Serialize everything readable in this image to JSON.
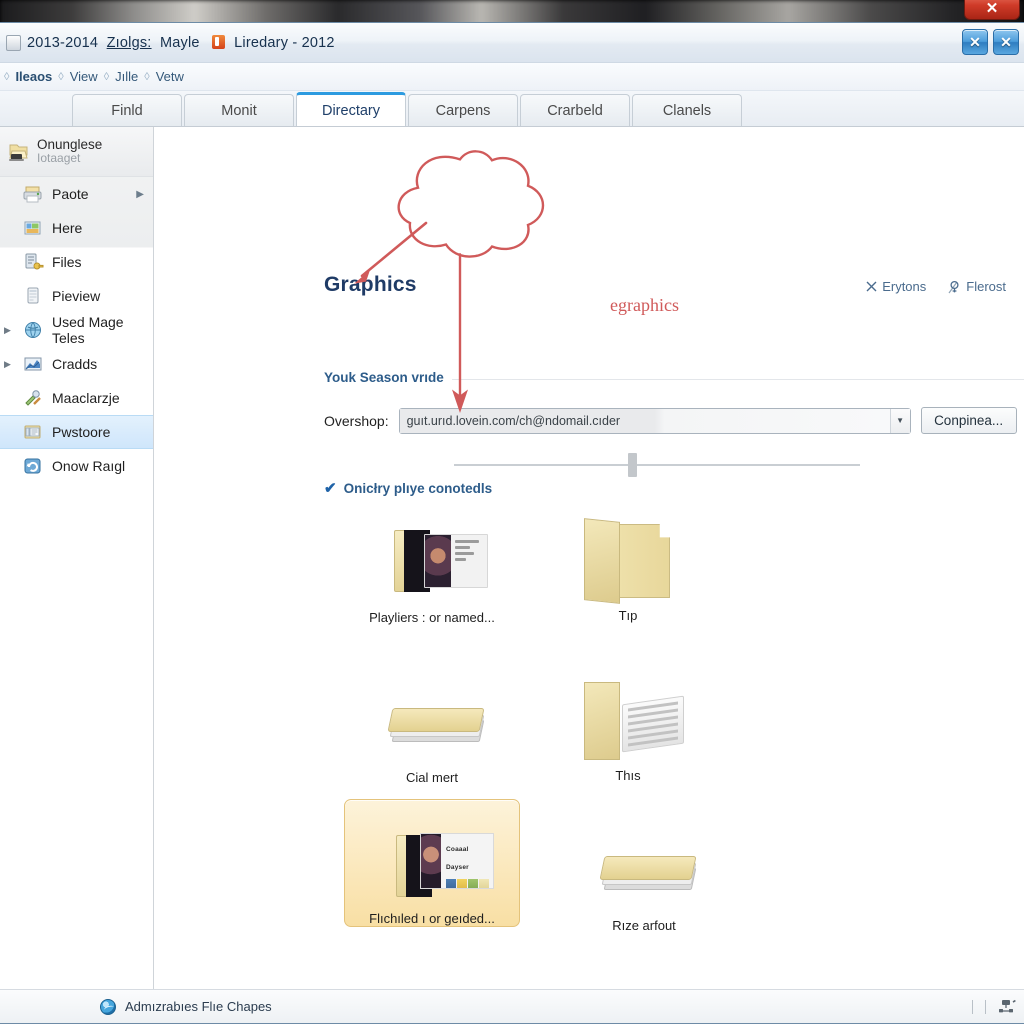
{
  "background": {
    "behind_window_close_label": "✕"
  },
  "titlebar": {
    "icon": "app-icon",
    "text_main": "2013-2014",
    "text_underlined": "Zıolgs:",
    "text_second": "Mayle",
    "firefox_icon": "firefox-icon",
    "text_third": "Liredary - 2012",
    "buttons": [
      {
        "name": "restore-button",
        "label": "✕"
      },
      {
        "name": "close-button",
        "label": "✕"
      }
    ]
  },
  "menubar": {
    "chevron": "◊",
    "items": [
      "Ileaos",
      "View",
      "Jılle",
      "Vetw"
    ]
  },
  "tabs": [
    {
      "label": "Finld",
      "active": false
    },
    {
      "label": "Monit",
      "active": false
    },
    {
      "label": "Directary",
      "active": true
    },
    {
      "label": "Carpens",
      "active": false
    },
    {
      "label": "Crarbeld",
      "active": false
    },
    {
      "label": "Clanels",
      "active": false
    }
  ],
  "sidebar": {
    "header": {
      "title": "Onunglese",
      "subtitle": "Iotaaget",
      "icon": "folder-laptop-icon"
    },
    "items": [
      {
        "label": "Paote",
        "icon": "printer-icon",
        "expander": "",
        "submenu_arrow": "▶",
        "selected": false
      },
      {
        "label": "Here",
        "icon": "picture-icon",
        "expander": "",
        "submenu_arrow": "",
        "selected": false
      },
      {
        "label": "Files",
        "icon": "files-key-icon",
        "expander": "",
        "submenu_arrow": "",
        "selected": false
      },
      {
        "label": "Pieview",
        "icon": "preview-icon",
        "expander": "",
        "submenu_arrow": "",
        "selected": false
      },
      {
        "label": "Used Mage Teles",
        "icon": "globe-icon",
        "expander": "▶",
        "submenu_arrow": "",
        "selected": false
      },
      {
        "label": "Cradds",
        "icon": "chart-icon",
        "expander": "▶",
        "submenu_arrow": "",
        "selected": false
      },
      {
        "label": "Maaclarzje",
        "icon": "tools-icon",
        "expander": "",
        "submenu_arrow": "",
        "selected": false
      },
      {
        "label": "Pwstoore",
        "icon": "restore-icon",
        "expander": "",
        "submenu_arrow": "",
        "selected": true
      },
      {
        "label": "Onow Raıgl",
        "icon": "refresh-icon",
        "expander": "",
        "submenu_arrow": "",
        "selected": false
      }
    ]
  },
  "main": {
    "page_title": "Graphics",
    "header_links": [
      {
        "icon": "close-x-icon",
        "label": "Erytons"
      },
      {
        "icon": "key-icon",
        "label": "Flerost"
      }
    ],
    "section_label": "Youk Season vrıde",
    "combo_row": {
      "label": "Overshop:",
      "value": "guıt.urıd.lovein.com/ch@ndomail.cıder",
      "dropdown_arrow": "▼",
      "button_label": "Conpinea..."
    },
    "checkbox": {
      "checked": true,
      "tick": "✔",
      "label": "Onicłry plıye conotedls"
    },
    "grid_items": [
      {
        "caption": "Playliers : or named...",
        "icon": "folder-with-document-preview",
        "selected": false
      },
      {
        "caption": "Tıp",
        "icon": "folder-open-empty",
        "selected": false
      },
      {
        "caption": "Cial mert",
        "caption_raw": "Cial mert",
        "icon": "folder-stack-closed",
        "selected": false
      },
      {
        "caption": "Thıs",
        "icon": "folder-open-documents",
        "selected": false
      },
      {
        "caption": "Flıchıled ı or geıded...",
        "icon": "folder-with-media-card",
        "selected": true,
        "card_title": "Coaaal Dayser"
      },
      {
        "caption": "Rıze arfout",
        "icon": "folder-stack-closed",
        "selected": false
      }
    ],
    "annotation": {
      "text": "egraphics",
      "color": "#d05a5a",
      "shape": "hand-drawn-cloud-with-two-arrows"
    }
  },
  "statusbar": {
    "icon": "globe-status-icon",
    "text": "Admızrabıes Flıe Chapes",
    "right_icon": "network-icon"
  },
  "colors": {
    "accent_blue": "#2d9be0",
    "title_text": "#17314e",
    "section_heading": "#2d5c8a",
    "selection_amber": "#f8dfa4",
    "selection_blue": "#cfe6fb",
    "annotation_red": "#d05a5a"
  }
}
